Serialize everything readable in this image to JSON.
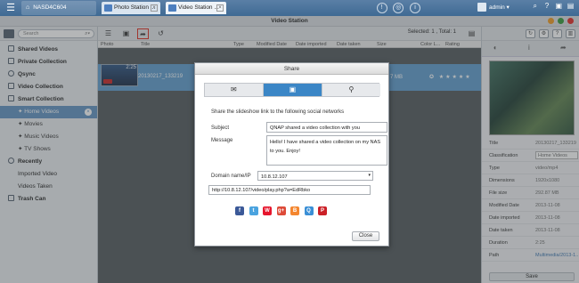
{
  "topbar": {
    "device_name": "NASD4C604",
    "tabs": [
      {
        "label": "Photo Station ..."
      },
      {
        "label": "Video Station ..."
      }
    ],
    "user": "admin",
    "colors": {
      "bar": "#4a75a0"
    }
  },
  "app": {
    "title": "Video Station",
    "window_buttons": [
      "#f0a030",
      "#43a047",
      "#e53935"
    ]
  },
  "sidebar": {
    "search_placeholder": "Search",
    "items": [
      {
        "label": "Shared Videos",
        "icon": "folder-icon"
      },
      {
        "label": "Private Collection",
        "icon": "lock-icon"
      },
      {
        "label": "Qsync",
        "icon": "sync-icon"
      },
      {
        "label": "Video Collection",
        "icon": "collection-icon"
      },
      {
        "label": "Smart Collection",
        "icon": "smart-icon"
      },
      {
        "label": "Home Videos",
        "icon": "home-icon",
        "count": "×"
      },
      {
        "label": "Movies",
        "icon": "movie-icon"
      },
      {
        "label": "Music Videos",
        "icon": "music-icon"
      },
      {
        "label": "TV Shows",
        "icon": "tv-icon"
      },
      {
        "label": "Recently",
        "icon": "clock-icon"
      },
      {
        "label": "Imported Video",
        "icon": ""
      },
      {
        "label": "Videos Taken",
        "icon": ""
      },
      {
        "label": "Trash Can",
        "icon": "trash-icon"
      }
    ]
  },
  "main": {
    "selected_info": "Selected: 1 , Total: 1",
    "columns": [
      "Photo",
      "Title",
      "Type",
      "Modified Date",
      "Date imported",
      "Date taken",
      "Size",
      "Color L...",
      "Rating"
    ],
    "row": {
      "duration": "2:25",
      "title": "20130217_133219",
      "size": "7 MB"
    }
  },
  "details": {
    "save_label": "Save",
    "props": [
      {
        "k": "Title",
        "v": "20130217_133219"
      },
      {
        "k": "Classification",
        "v": "Home Videos"
      },
      {
        "k": "Type",
        "v": "video/mp4"
      },
      {
        "k": "Dimensions",
        "v": "1920x1080"
      },
      {
        "k": "File size",
        "v": "292.87 MB"
      },
      {
        "k": "Modified Date",
        "v": "2013-11-08"
      },
      {
        "k": "Date imported",
        "v": "2013-11-08"
      },
      {
        "k": "Date taken",
        "v": "2013-11-08"
      },
      {
        "k": "Duration",
        "v": "2:25"
      },
      {
        "k": "Path",
        "v": "Multimedia/2013-1..."
      }
    ]
  },
  "share": {
    "title": "Share",
    "description": "Share the slideshow link to the following social networks",
    "subject_label": "Subject",
    "subject_value": "QNAP shared a video collection with you",
    "message_label": "Message",
    "message_value": "Hello! I have shared a video collection on my NAS to you. Enjoy!",
    "domain_label": "Domain name/IP",
    "domain_value": "10.8.12.107",
    "url": "http://10.8.12.107/video/play.php?a=EdRbko",
    "close_label": "Close",
    "social": [
      {
        "name": "facebook-icon",
        "glyph": "f",
        "color": "#3b5998"
      },
      {
        "name": "twitter-icon",
        "glyph": "t",
        "color": "#4aa3df"
      },
      {
        "name": "weibo-icon",
        "glyph": "W",
        "color": "#e6162d"
      },
      {
        "name": "googleplus-icon",
        "glyph": "g+",
        "color": "#dd4b39"
      },
      {
        "name": "blogger-icon",
        "glyph": "B",
        "color": "#f4862f"
      },
      {
        "name": "qzone-icon",
        "glyph": "Q",
        "color": "#3a8fd6"
      },
      {
        "name": "pinterest-icon",
        "glyph": "P",
        "color": "#cb2027"
      }
    ]
  }
}
